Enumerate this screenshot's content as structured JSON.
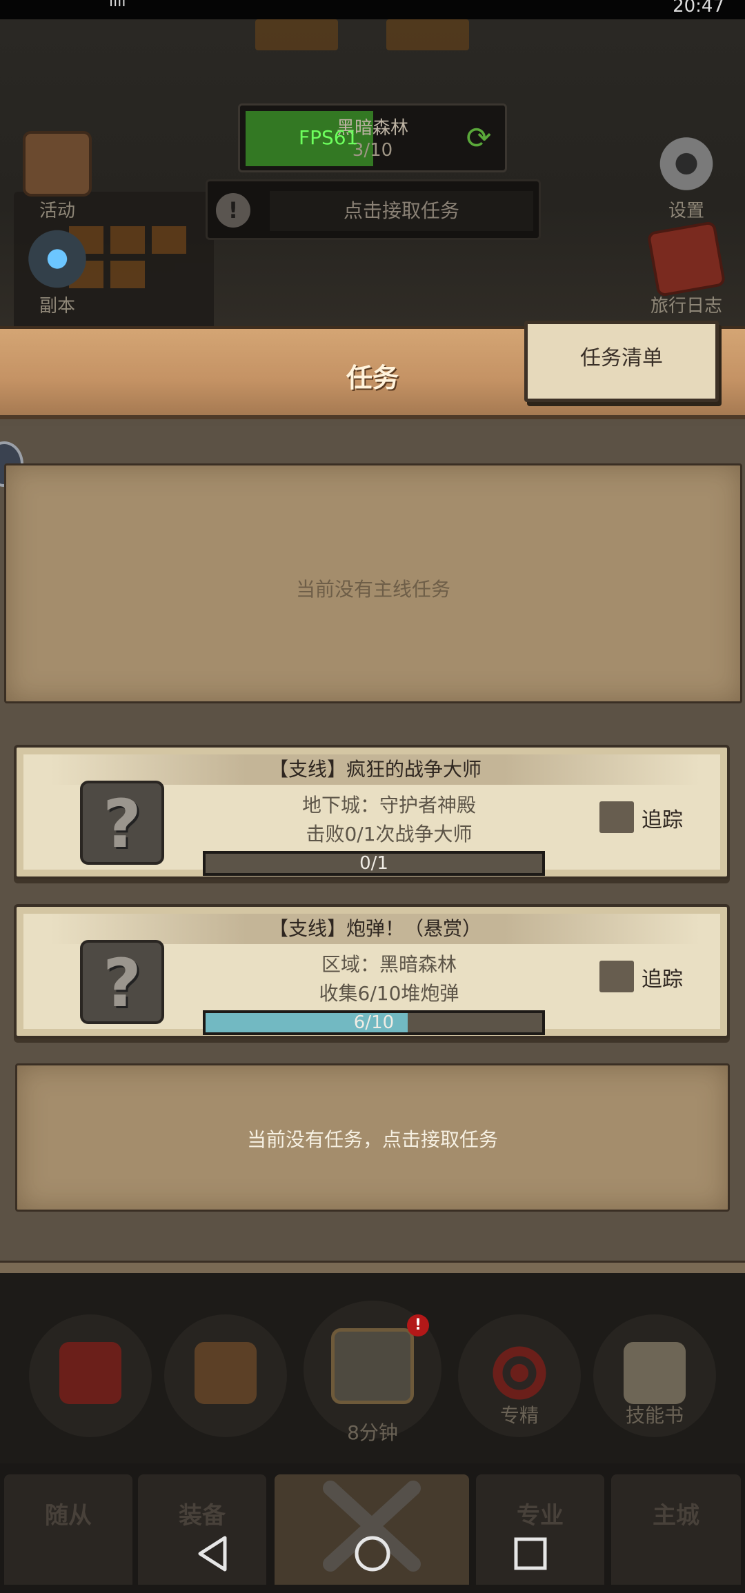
{
  "status_bar": {
    "signal": "ılıl",
    "time": "20:47"
  },
  "top_hud": {
    "region_name": "黑暗森林",
    "region_count": "3/10",
    "fps": "FPS61",
    "accept_quest": "点击接取任务",
    "left_buttons": [
      {
        "label": "活动",
        "icon": "activity-icon"
      },
      {
        "label": "副本",
        "icon": "dungeon-portal-icon"
      }
    ],
    "right_buttons": [
      {
        "label": "设置",
        "icon": "gear-icon"
      },
      {
        "label": "旅行日志",
        "icon": "journal-icon"
      }
    ]
  },
  "panel": {
    "title": "任务",
    "tasklist_button": "任务清单",
    "main_empty": "当前没有主线任务",
    "quests": [
      {
        "title": "【支线】疯狂的战争大师",
        "line1": "地下城：守护者神殿",
        "line2": "击败0/1次战争大师",
        "progress_text": "0/1",
        "progress": 0.0,
        "track_label": "追踪"
      },
      {
        "title": "【支线】炮弹！（悬赏）",
        "line1": "区域：黑暗森林",
        "line2": "收集6/10堆炮弹",
        "progress_text": "6/10",
        "progress": 0.6,
        "track_label": "追踪"
      }
    ],
    "empty_quest_slot": "当前没有任务，点击接取任务"
  },
  "bottom_hud": {
    "circle_buttons": [
      {
        "label": "",
        "icon": "potion-icon"
      },
      {
        "label": "",
        "icon": "bread-icon"
      },
      {
        "label": "",
        "icon": "chest-icon"
      },
      {
        "label": "专精",
        "icon": "target-icon"
      },
      {
        "label": "技能书",
        "icon": "skill-book-icon"
      }
    ],
    "chest_badge": "!",
    "chest_timer": "8分钟",
    "tabs": [
      "随从",
      "装备",
      "",
      "专业",
      "主城"
    ]
  },
  "colors": {
    "header": "#c49264",
    "parchment": "#e9dfc3",
    "progress_fill": "#72b9c2",
    "fps": "#6dff5d"
  }
}
